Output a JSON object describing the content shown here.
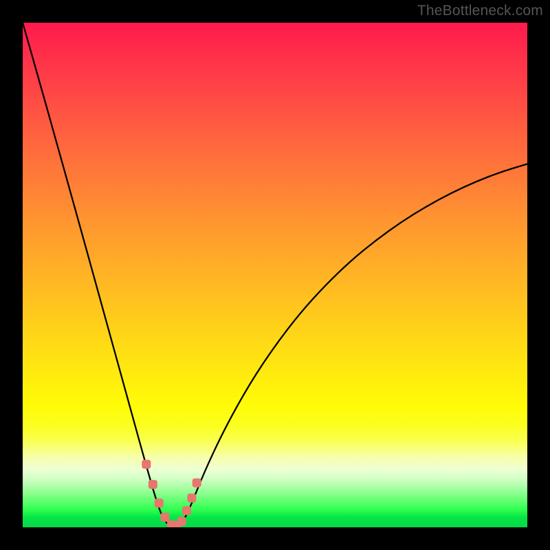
{
  "watermark": "TheBottleneck.com",
  "colors": {
    "frame": "#000000",
    "curve": "#000000",
    "marker": "#e8766e",
    "gradient_top": "#ff1a4d",
    "gradient_mid": "#ffd617",
    "gradient_bottom": "#03d94a"
  },
  "chart_data": {
    "type": "line",
    "title": "",
    "xlabel": "",
    "ylabel": "",
    "xlim": [
      0,
      100
    ],
    "ylim": [
      0,
      100
    ],
    "x": [
      0,
      3,
      6,
      9,
      12,
      15,
      18,
      21,
      24,
      27,
      28.5,
      30,
      31.5,
      33,
      36,
      40,
      45,
      50,
      55,
      60,
      65,
      70,
      75,
      80,
      85,
      90,
      95,
      100
    ],
    "values": [
      100,
      89.5,
      78.8,
      68.1,
      57.3,
      46.5,
      35.6,
      24.8,
      13.9,
      3.5,
      0.7,
      0,
      0.7,
      3.5,
      11.0,
      19.5,
      28.5,
      36.0,
      42.5,
      48.0,
      52.8,
      56.9,
      60.5,
      63.6,
      66.3,
      68.6,
      70.5,
      72.0
    ],
    "markers_x": [
      24.5,
      25.8,
      27.0,
      28.2,
      29.5,
      30.5,
      31.5,
      32.5,
      33.5,
      34.5
    ],
    "markers_y": [
      12.5,
      8.5,
      4.8,
      2.0,
      0.5,
      0.3,
      1.2,
      3.3,
      5.8,
      8.8
    ]
  }
}
